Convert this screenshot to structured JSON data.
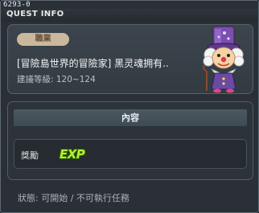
{
  "window": {
    "quest_id": "6293-0",
    "title": "QUEST INFO"
  },
  "info": {
    "job_badge": "職業",
    "quest_name": "[冒險島世界的冒險家] 黑灵魂拥有..",
    "level_requirement": "建議等級: 120~124"
  },
  "npc": {
    "icon": "clown-npc-portrait"
  },
  "content": {
    "header": "內容",
    "reward_label": "獎勵",
    "reward_icon_text": "EXP"
  },
  "status": {
    "text": "狀態: 可開始 / 不可執行任務"
  },
  "colors": {
    "background": "#2a3036",
    "badge": "#cbb89c",
    "exp_green": "#b5f032"
  }
}
